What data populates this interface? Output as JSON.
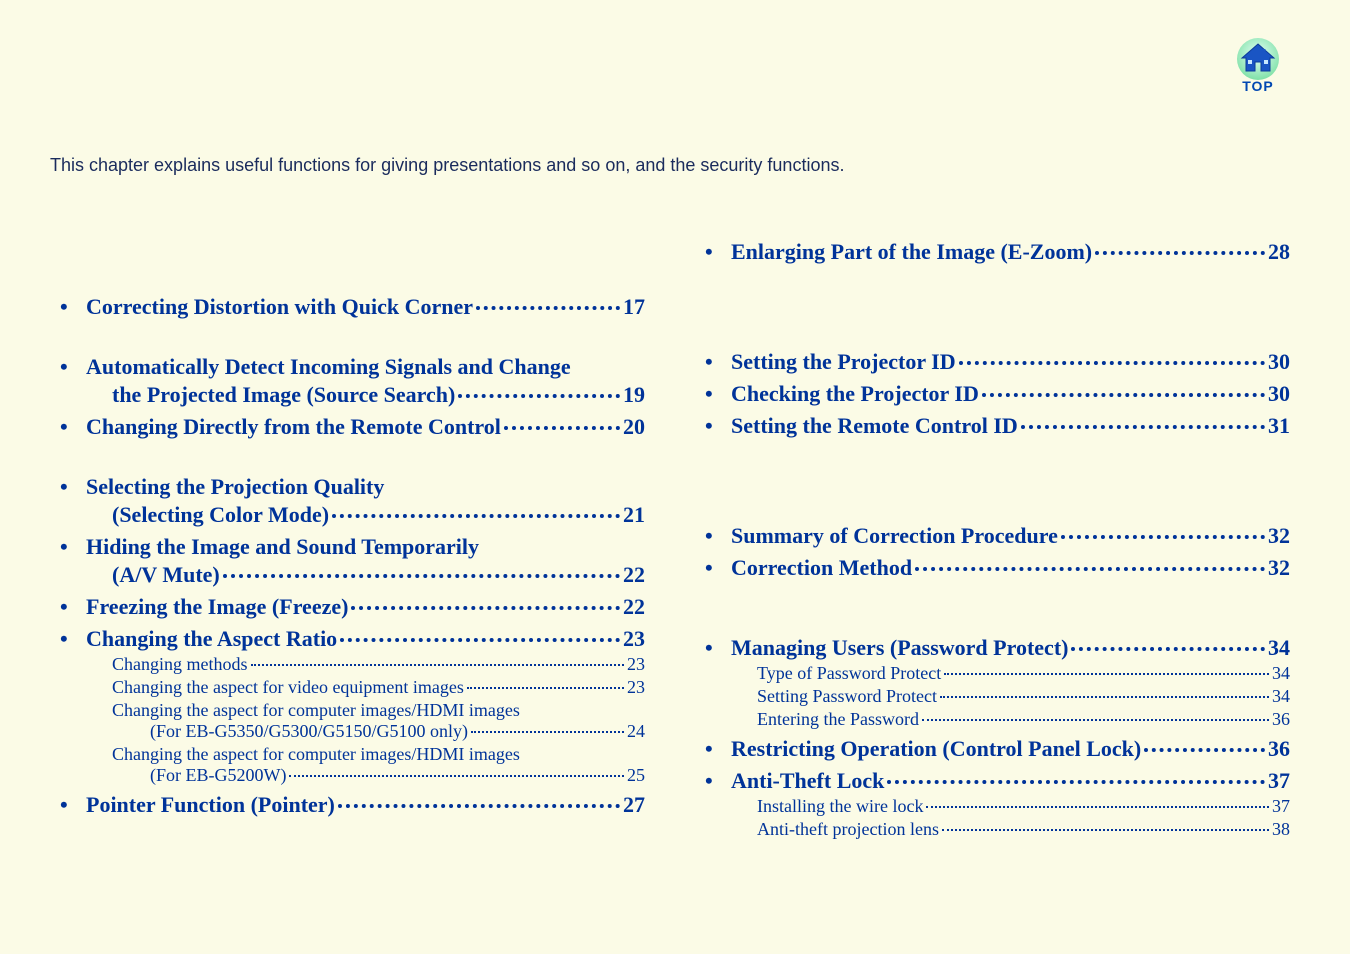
{
  "icon": {
    "label": "TOP"
  },
  "intro": "This chapter explains useful functions for giving presentations and so on, and the security functions.",
  "left": {
    "g1": {
      "i1": {
        "label": "Correcting Distortion with Quick Corner",
        "page": "17"
      }
    },
    "g2": {
      "i1a": {
        "label": "Automatically Detect Incoming Signals and Change"
      },
      "i1b": {
        "label": "the Projected Image (Source Search)",
        "page": "19"
      },
      "i2": {
        "label": "Changing Directly from the Remote Control",
        "page": "20"
      }
    },
    "g3": {
      "i1a": {
        "label": "Selecting the Projection Quality"
      },
      "i1b": {
        "label": "(Selecting Color Mode)",
        "page": "21"
      },
      "i2a": {
        "label": "Hiding the Image and Sound Temporarily"
      },
      "i2b": {
        "label": "(A/V Mute)",
        "page": "22"
      },
      "i3": {
        "label": "Freezing the Image (Freeze)",
        "page": "22"
      },
      "i4": {
        "label": "Changing the Aspect Ratio",
        "page": "23"
      },
      "s1": {
        "label": "Changing methods",
        "page": "23"
      },
      "s2": {
        "label": "Changing the aspect for video equipment images",
        "page": "23"
      },
      "s3a": {
        "label": "Changing the aspect for computer images/HDMI images"
      },
      "s3b": {
        "label": "(For EB-G5350/G5300/G5150/G5100 only)",
        "page": "24"
      },
      "s4a": {
        "label": "Changing the aspect for computer images/HDMI images"
      },
      "s4b": {
        "label": "(For EB-G5200W)",
        "page": "25"
      },
      "i5": {
        "label": "Pointer Function (Pointer)",
        "page": "27"
      }
    }
  },
  "right": {
    "g1": {
      "i1": {
        "label": "Enlarging Part of the Image (E-Zoom)",
        "page": "28"
      }
    },
    "g2": {
      "i1": {
        "label": "Setting the Projector ID",
        "page": "30"
      },
      "i2": {
        "label": "Checking the Projector ID",
        "page": "30"
      },
      "i3": {
        "label": "Setting the Remote Control ID",
        "page": "31"
      }
    },
    "g3": {
      "i1": {
        "label": "Summary of Correction Procedure",
        "page": "32"
      },
      "i2": {
        "label": "Correction Method",
        "page": "32"
      }
    },
    "g4": {
      "i1": {
        "label": "Managing Users (Password Protect)",
        "page": "34"
      },
      "s1": {
        "label": "Type of Password Protect",
        "page": "34"
      },
      "s2": {
        "label": "Setting Password Protect",
        "page": "34"
      },
      "s3": {
        "label": "Entering the Password",
        "page": "36"
      },
      "i2": {
        "label": "Restricting Operation (Control Panel Lock)",
        "page": "36"
      },
      "i3": {
        "label": "Anti-Theft Lock",
        "page": "37"
      },
      "s4": {
        "label": "Installing the wire lock",
        "page": "37"
      },
      "s5": {
        "label": "Anti-theft projection lens",
        "page": "38"
      }
    }
  }
}
